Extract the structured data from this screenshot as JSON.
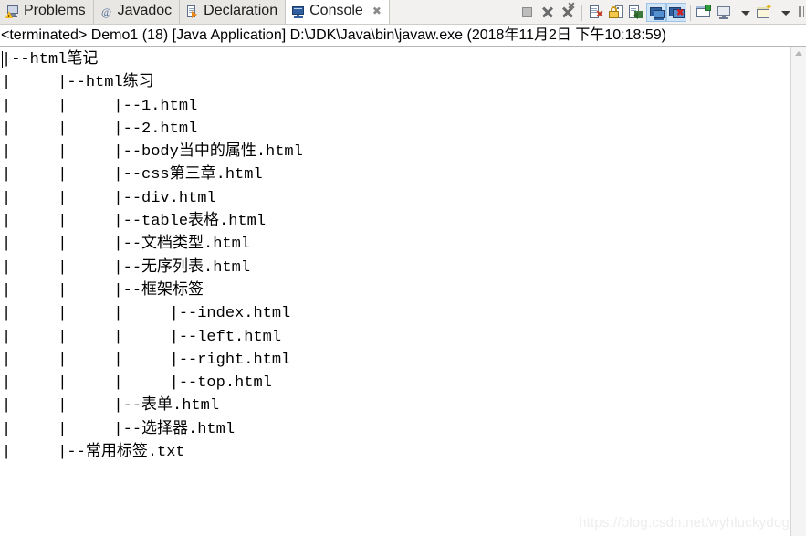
{
  "window": {
    "title": "Console"
  },
  "tabs": [
    {
      "label": "Problems",
      "icon": "problems-icon",
      "active": false,
      "closable": false
    },
    {
      "label": "Javadoc",
      "icon": "javadoc-icon",
      "active": false,
      "closable": false
    },
    {
      "label": "Declaration",
      "icon": "declaration-icon",
      "active": false,
      "closable": false
    },
    {
      "label": "Console",
      "icon": "console-icon",
      "active": true,
      "closable": true,
      "close_glyph": "✖"
    }
  ],
  "toolbar": {
    "buttons": [
      {
        "name": "terminate-button",
        "icon": "stop-square-icon",
        "toggled": false
      },
      {
        "name": "remove-launch-button",
        "icon": "x-icon",
        "toggled": false
      },
      {
        "name": "remove-all-terminated-button",
        "icon": "xx-icon",
        "toggled": false
      },
      {
        "name": "clear-console-button",
        "icon": "clear-console-icon",
        "toggled": false
      },
      {
        "name": "scroll-lock-button",
        "icon": "lock-icon",
        "toggled": false
      },
      {
        "name": "word-wrap-button",
        "icon": "pin-console-icon",
        "toggled": false
      },
      {
        "name": "show-console-on-output-button",
        "icon": "display-console-icon",
        "toggled": true
      },
      {
        "name": "show-console-on-error-button",
        "icon": "new-console-error-icon",
        "toggled": true
      },
      {
        "name": "pin-console-button",
        "icon": "open-console-icon",
        "toggled": false
      },
      {
        "name": "display-selected-console-button",
        "icon": "monitor-icon",
        "toggled": false
      },
      {
        "name": "display-console-dropdown",
        "icon": "chevron-down-icon",
        "toggled": false
      },
      {
        "name": "open-console-button",
        "icon": "new-window-icon",
        "toggled": false
      },
      {
        "name": "open-console-dropdown",
        "icon": "chevron-down-icon",
        "toggled": false
      },
      {
        "name": "view-menu-button",
        "icon": "view-menu-icon",
        "toggled": false
      }
    ]
  },
  "console": {
    "header": "<terminated> Demo1 (18) [Java Application] D:\\JDK\\Java\\bin\\javaw.exe (2018年11月2日 下午10:18:59)",
    "output": "|--html笔记\n|     |--html练习\n|     |     |--1.html\n|     |     |--2.html\n|     |     |--body当中的属性.html\n|     |     |--css第三章.html\n|     |     |--div.html\n|     |     |--table表格.html\n|     |     |--文档类型.html\n|     |     |--无序列表.html\n|     |     |--框架标签\n|     |     |     |--index.html\n|     |     |     |--left.html\n|     |     |     |--right.html\n|     |     |     |--top.html\n|     |     |--表单.html\n|     |     |--选择器.html\n|     |--常用标签.txt",
    "lines": [
      "|--html笔记",
      "|     |--html练习",
      "|     |     |--1.html",
      "|     |     |--2.html",
      "|     |     |--body当中的属性.html",
      "|     |     |--css第三章.html",
      "|     |     |--div.html",
      "|     |     |--table表格.html",
      "|     |     |--文档类型.html",
      "|     |     |--无序列表.html",
      "|     |     |--框架标签",
      "|     |     |     |--index.html",
      "|     |     |     |--left.html",
      "|     |     |     |--right.html",
      "|     |     |     |--top.html",
      "|     |     |--表单.html",
      "|     |     |--选择器.html",
      "|     |--常用标签.txt"
    ]
  },
  "watermark": {
    "text": "https://blog.csdn.net/wyhluckydog"
  },
  "colors": {
    "tab_active_bg": "#ffffff",
    "tab_inactive_bg": "#e9e7e4",
    "toolbar_bg": "#f2f1f0",
    "toggle_active_bg": "#cfe4f7",
    "console_bg": "#ffffff",
    "console_text": "#000000",
    "watermark": "#ededed"
  }
}
